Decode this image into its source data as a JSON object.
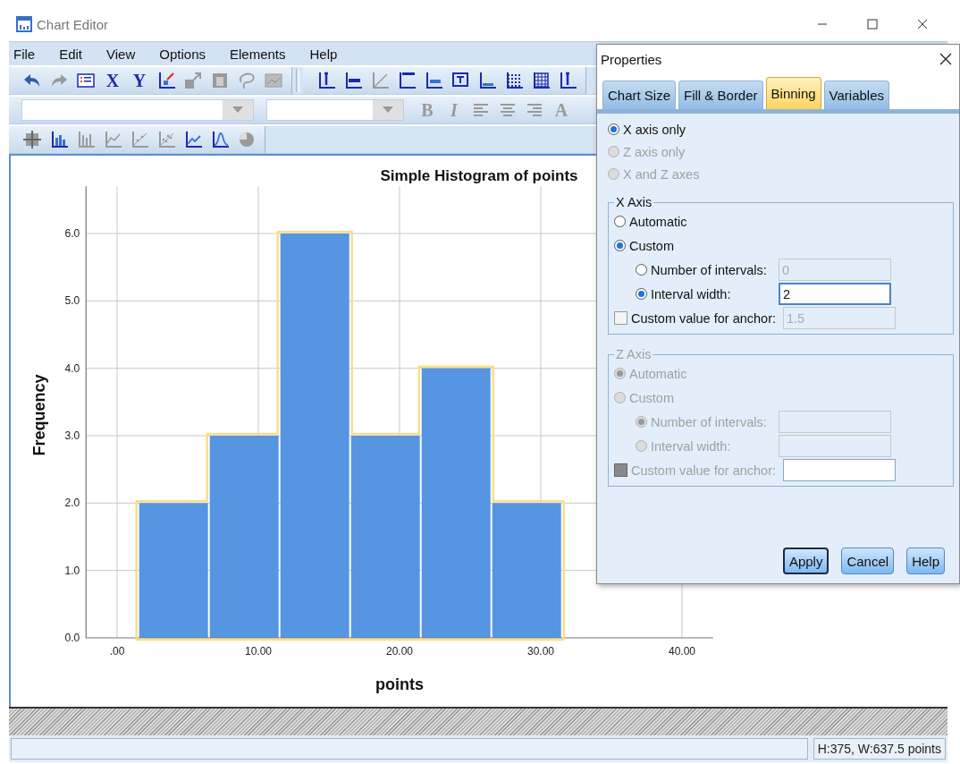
{
  "window": {
    "title": "Chart Editor"
  },
  "menu": [
    "File",
    "Edit",
    "View",
    "Options",
    "Elements",
    "Help"
  ],
  "toolbars": [
    {
      "items": [
        {
          "kind": "icon",
          "disabled": false
        },
        {
          "kind": "icon",
          "disabled": true
        },
        {
          "kind": "icon",
          "disabled": false
        },
        {
          "kind": "text",
          "label": "X",
          "disabled": false
        },
        {
          "kind": "text",
          "label": "Y",
          "disabled": false
        },
        {
          "kind": "icon",
          "disabled": false
        },
        {
          "kind": "icon",
          "disabled": true
        },
        {
          "kind": "icon",
          "disabled": true
        },
        {
          "kind": "icon",
          "disabled": true
        },
        {
          "kind": "icon",
          "disabled": true
        },
        {
          "kind": "separator"
        },
        {
          "kind": "icon",
          "disabled": false
        },
        {
          "kind": "icon",
          "disabled": false
        },
        {
          "kind": "icon",
          "disabled": true
        },
        {
          "kind": "icon",
          "disabled": false
        },
        {
          "kind": "icon",
          "disabled": false
        },
        {
          "kind": "icon",
          "disabled": false
        },
        {
          "kind": "icon",
          "disabled": false
        },
        {
          "kind": "icon",
          "disabled": false
        },
        {
          "kind": "icon",
          "disabled": false
        },
        {
          "kind": "icon",
          "disabled": false
        }
      ]
    },
    {
      "items": [
        {
          "kind": "combo",
          "disabled": false
        },
        {
          "kind": "combo",
          "disabled": false
        },
        {
          "kind": "text",
          "label": "B",
          "disabled": true
        },
        {
          "kind": "text",
          "label": "I",
          "disabled": true
        },
        {
          "kind": "icon",
          "disabled": true
        },
        {
          "kind": "icon",
          "disabled": true
        },
        {
          "kind": "icon",
          "disabled": true
        },
        {
          "kind": "text",
          "label": "A",
          "disabled": true
        }
      ]
    },
    {
      "items": [
        {
          "kind": "icon",
          "disabled": true
        },
        {
          "kind": "icon",
          "disabled": false
        },
        {
          "kind": "icon",
          "disabled": true
        },
        {
          "kind": "icon",
          "disabled": true
        },
        {
          "kind": "icon",
          "disabled": true
        },
        {
          "kind": "icon",
          "disabled": true
        },
        {
          "kind": "icon",
          "disabled": false
        },
        {
          "kind": "icon",
          "disabled": false
        },
        {
          "kind": "icon",
          "disabled": true
        }
      ]
    }
  ],
  "chart": {
    "bars_selected": true,
    "chart_data": {
      "type": "bar",
      "grid": true,
      "title": "Simple Histogram of points",
      "xlabel": "points",
      "ylabel": "Frequency",
      "x": [
        4,
        9,
        14,
        19,
        24,
        29
      ],
      "values": [
        2,
        3,
        6,
        3,
        4,
        2
      ],
      "xlim": [
        -2.2,
        42.2
      ],
      "ylim": [
        0,
        6.7
      ],
      "xticks": [
        {
          "value": 0,
          "label": ".00"
        },
        {
          "value": 10,
          "label": "10.00"
        },
        {
          "value": 20,
          "label": "20.00"
        },
        {
          "value": 30,
          "label": "30.00"
        },
        {
          "value": 40,
          "label": "40.00"
        }
      ],
      "yticks": [
        {
          "value": 0,
          "label": "0.0"
        },
        {
          "value": 1,
          "label": "1.0"
        },
        {
          "value": 2,
          "label": "2.0"
        },
        {
          "value": 3,
          "label": "3.0"
        },
        {
          "value": 4,
          "label": "4.0"
        },
        {
          "value": 5,
          "label": "5.0"
        },
        {
          "value": 6,
          "label": "6.0"
        }
      ]
    }
  },
  "dialog": {
    "title": "Properties",
    "tabs": [
      {
        "label": "Chart Size",
        "selected": false
      },
      {
        "label": "Fill & Border",
        "selected": false
      },
      {
        "label": "Binning",
        "selected": true
      },
      {
        "label": "Variables",
        "selected": false
      }
    ],
    "scope_options": [
      {
        "label": "X axis only",
        "selected": true,
        "disabled": false
      },
      {
        "label": "Z axis only",
        "selected": false,
        "disabled": true
      },
      {
        "label": "X and Z axes",
        "selected": false,
        "disabled": true
      }
    ],
    "axes": [
      {
        "legend": "X Axis",
        "disabled": false,
        "modes": [
          {
            "label": "Automatic",
            "selected": false
          },
          {
            "label": "Custom",
            "selected": true
          }
        ],
        "sub_options": [
          {
            "label": "Number of intervals:",
            "selected": false,
            "value": "0",
            "field_disabled": true,
            "focused": false
          },
          {
            "label": "Interval width:",
            "selected": true,
            "value": "2",
            "field_disabled": false,
            "focused": true
          }
        ],
        "anchor": {
          "label": "Custom value for anchor:",
          "checked": false,
          "value": "1.5",
          "field_disabled": true
        }
      },
      {
        "legend": "Z Axis",
        "disabled": true,
        "modes": [
          {
            "label": "Automatic",
            "selected": true
          },
          {
            "label": "Custom",
            "selected": false
          }
        ],
        "sub_options": [
          {
            "label": "Number of intervals:",
            "selected": true,
            "field_disabled": true,
            "focused": false
          },
          {
            "label": "Interval width:",
            "selected": false,
            "field_disabled": true,
            "focused": false
          }
        ],
        "anchor": {
          "label": "Custom value for anchor:",
          "checked": false,
          "field_disabled": false
        }
      }
    ],
    "buttons": [
      {
        "label": "Apply",
        "focused": true
      },
      {
        "label": "Cancel",
        "focused": false
      },
      {
        "label": "Help",
        "focused": false
      }
    ]
  },
  "status_bar": {
    "text": "H:375, W:637.5 points"
  }
}
